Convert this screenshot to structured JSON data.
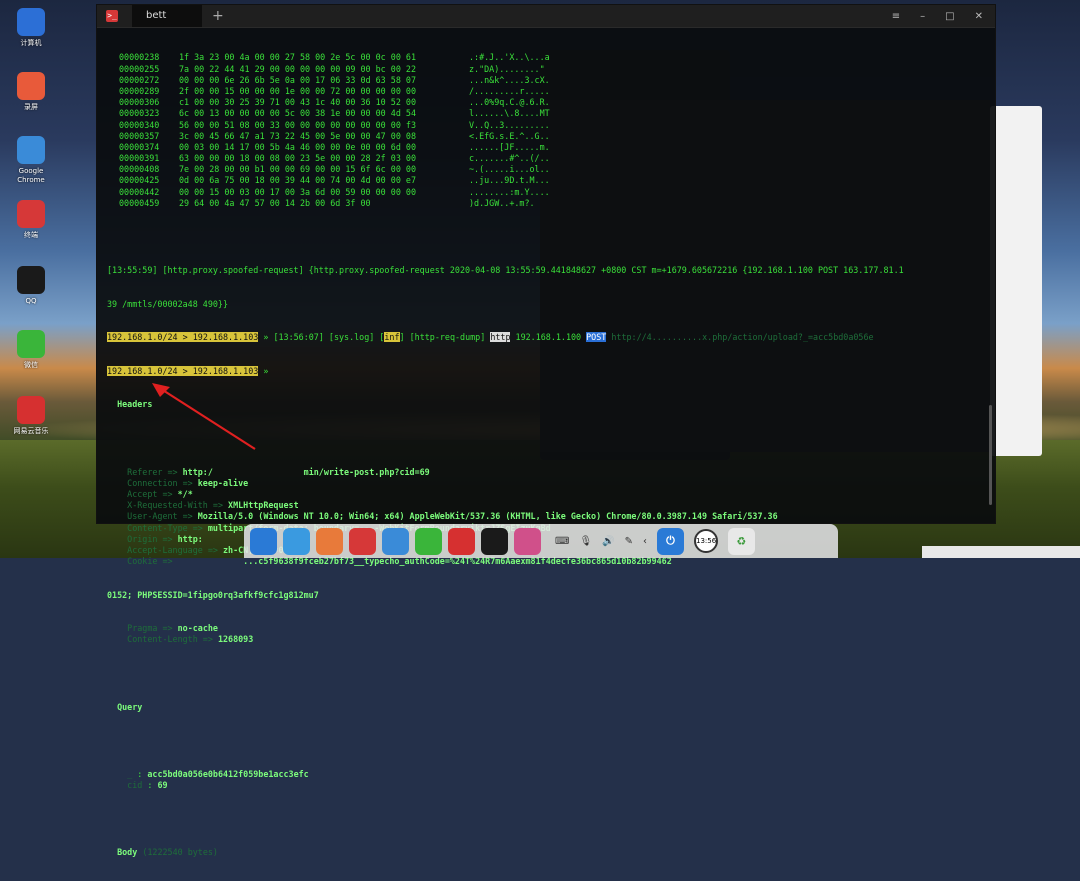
{
  "desktop": {
    "icons": [
      {
        "label": "计算机",
        "icon": "computer-icon",
        "color": "#2c6fd6"
      },
      {
        "label": "录屏",
        "icon": "record-icon",
        "color": "#e85a3a"
      },
      {
        "label": "Google Chrome",
        "icon": "chrome-icon",
        "color": "#3a8bd8"
      },
      {
        "label": "终端",
        "icon": "terminal-icon",
        "color": "#d63838"
      },
      {
        "label": "QQ",
        "icon": "qq-icon",
        "color": "#1a1a1a"
      },
      {
        "label": "微信",
        "icon": "wechat-icon",
        "color": "#3ab53a"
      },
      {
        "label": "网易云音乐",
        "icon": "netease-music-icon",
        "color": "#d63030"
      }
    ]
  },
  "terminal": {
    "tab_title": "bett",
    "new_tab": "+",
    "controls": {
      "menu": "≡",
      "minimize": "–",
      "maximize": "□",
      "close": "✕"
    },
    "hexdump": [
      {
        "addr": "00000238",
        "bytes": "1f 3a 23 00 4a 00 00 27 58 00 2e 5c 00 0c 00 61",
        "ascii": ".:#.J..'X..\\...a"
      },
      {
        "addr": "00000255",
        "bytes": "7a 00 22 44 41 29 00 00 00 00 00 09 00 bc 00 22",
        "ascii": "z.\"DA)........\""
      },
      {
        "addr": "00000272",
        "bytes": "00 00 00 6e 26 6b 5e 0a 00 17 06 33 0d 63 58 07",
        "ascii": "...n&k^....3.cX."
      },
      {
        "addr": "00000289",
        "bytes": "2f 00 00 15 00 00 00 1e 00 00 72 00 00 00 00 00",
        "ascii": "/.........r....."
      },
      {
        "addr": "00000306",
        "bytes": "c1 00 00 30 25 39 71 00 43 1c 40 00 36 10 52 00",
        "ascii": "...0%9q.C.@.6.R."
      },
      {
        "addr": "00000323",
        "bytes": "6c 00 13 00 00 00 00 5c 00 38 1e 00 00 00 4d 54",
        "ascii": "l......\\.8....MT"
      },
      {
        "addr": "00000340",
        "bytes": "56 00 00 51 08 00 33 00 00 00 00 00 00 00 00 f3",
        "ascii": "V..Q..3........."
      },
      {
        "addr": "00000357",
        "bytes": "3c 00 45 66 47 a1 73 22 45 00 5e 00 00 47 00 08",
        "ascii": "<.EfG.s.E.^..G.."
      },
      {
        "addr": "00000374",
        "bytes": "00 03 00 14 17 00 5b 4a 46 00 00 0e 00 00 6d 00",
        "ascii": "......[JF.....m."
      },
      {
        "addr": "00000391",
        "bytes": "63 00 00 00 18 00 08 00 23 5e 00 00 28 2f 03 00",
        "ascii": "c.......#^..(/.."
      },
      {
        "addr": "00000408",
        "bytes": "7e 00 28 00 00 b1 00 00 69 00 00 15 6f 6c 00 00",
        "ascii": "~.(.....i...ol.."
      },
      {
        "addr": "00000425",
        "bytes": "0d 00 6a 75 00 18 00 39 44 00 74 00 4d 00 00 e7",
        "ascii": "..ju...9D.t.M..."
      },
      {
        "addr": "00000442",
        "bytes": "00 00 15 00 03 00 17 00 3a 6d 00 59 00 00 00 00",
        "ascii": "........:m.Y...."
      },
      {
        "addr": "00000459",
        "bytes": "29 64 00 4a 47 57 00 14 2b 00 6d 3f 00",
        "ascii": ")d.JGW..+.m?."
      }
    ],
    "proxy_line_1": "[13:55:59] [http.proxy.spoofed-request] {http.proxy.spoofed-request 2020-04-08 13:55:59.441848627 +0800 CST m=+1679.605672216 {192.168.1.100 POST 163.177.81.1",
    "proxy_line_2": "39 /mmtls/00002a48 490}}",
    "prompt_subnet": "192.168.1.0/24",
    "prompt_arrow": " > ",
    "prompt_host": "192.168.1.103",
    "prompt_sep": " » ",
    "log_time": "[13:56:07]",
    "log_tag": "[sys.log]",
    "log_level": "inf",
    "log_module": "[http-req-dump]",
    "log_proto": "http",
    "log_src": "192.168.1.100",
    "log_method": "POST",
    "log_url": "http://4..........x.php/action/upload?_=acc5bd0a056e",
    "headers_label": "Headers",
    "headers": [
      {
        "key": "Referer",
        "value": "http:/                  min/write-post.php?cid=69"
      },
      {
        "key": "Connection",
        "value": "keep-alive"
      },
      {
        "key": "Accept",
        "value": "*/*"
      },
      {
        "key": "X-Requested-With",
        "value": "XMLHttpRequest"
      },
      {
        "key": "User-Agent",
        "value": "Mozilla/5.0 (Windows NT 10.0; Win64; x64) AppleWebKit/537.36 (KHTML, like Gecko) Chrome/80.0.3987.149 Safari/537.36"
      },
      {
        "key": "Content-Type",
        "value": "multipart/form-data; boundary=----WebKitFormBoundaryiktrJZSgEIzuKqBd"
      },
      {
        "key": "Origin",
        "value": "http:"
      },
      {
        "key": "Accept-Language",
        "value": "zh-CN,zh;q=0.9"
      },
      {
        "key": "Cookie",
        "value": "             ...c5f9638f9fceb27bf73__typecho_authCode=%24T%24R7m6Aaexm81f4decfe36bc865d10b82b99462"
      }
    ],
    "cookie_cont": "0152; PHPSESSID=1fipgo0rq3afkf9cfc1g812mu7",
    "headers_after": [
      {
        "key": "Pragma",
        "value": "no-cache"
      },
      {
        "key": "Content-Length",
        "value": "1268093"
      }
    ],
    "query_label": "Query",
    "query": [
      {
        "key": "_",
        "value": "acc5bd0a056e0b6412f059be1acc3efc"
      },
      {
        "key": "cid",
        "value": "69"
      }
    ],
    "body_label": "Body",
    "body_size": "(1222540 bytes)"
  },
  "dock": {
    "apps": [
      {
        "name": "launcher",
        "color": "#2a7ad6"
      },
      {
        "name": "file-manager",
        "color": "#3a9ae0"
      },
      {
        "name": "screen-recorder",
        "color": "#e87a3a"
      },
      {
        "name": "terminal",
        "color": "#d63838"
      },
      {
        "name": "chrome",
        "color": "#3a8bd8"
      },
      {
        "name": "wechat",
        "color": "#3ab53a"
      },
      {
        "name": "netease-music",
        "color": "#d63030"
      },
      {
        "name": "qq",
        "color": "#1a1a1a"
      },
      {
        "name": "settings",
        "color": "#d0508a"
      }
    ],
    "tray": [
      "⌨",
      "🎙",
      "🔊",
      "✎"
    ],
    "clock_label": "13:56",
    "collapse": "‹"
  }
}
